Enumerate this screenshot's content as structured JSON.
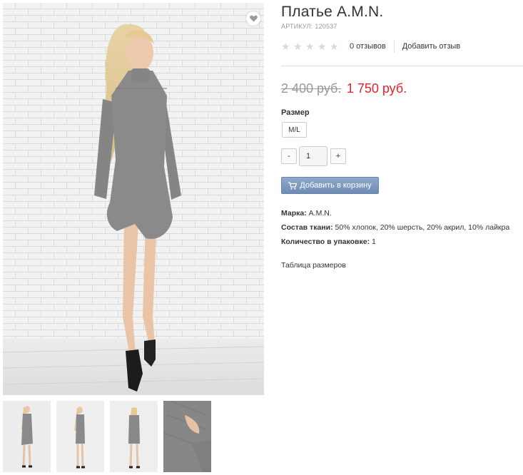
{
  "product": {
    "title": "Платье A.M.N.",
    "sku_label": "АРТИКУЛ:",
    "sku_value": "120537",
    "rating": {
      "stars": 0,
      "max_stars": 5
    },
    "reviews_count": "0 отзывов",
    "add_review": "Добавить отзыв",
    "old_price": "2 400 руб.",
    "new_price": "1 750 руб.",
    "size_label": "Размер",
    "size_option": "M/L",
    "qty_minus": "-",
    "qty_value": "1",
    "qty_plus": "+",
    "cart_button": "Добавить в корзину",
    "attributes": [
      {
        "label": "Марка:",
        "value": "A.M.N."
      },
      {
        "label": "Состав ткани:",
        "value": "50% хлопок, 20% шерсть, 20% акрил, 10% лайкра"
      },
      {
        "label": "Количество в упаковке:",
        "value": "1"
      }
    ],
    "size_table_link": "Таблица размеров"
  },
  "gallery": {
    "thumbnails": 4
  },
  "colors": {
    "price_new": "#e6232c",
    "price_old": "#999999",
    "cart_button": "#7c97bd",
    "dress": "#8c8c8c",
    "wall": "#f0f0f0",
    "floor": "#e6e6e6"
  },
  "icons": {
    "wishlist": "heart-icon",
    "cart": "cart-icon",
    "star": "star-icon"
  }
}
